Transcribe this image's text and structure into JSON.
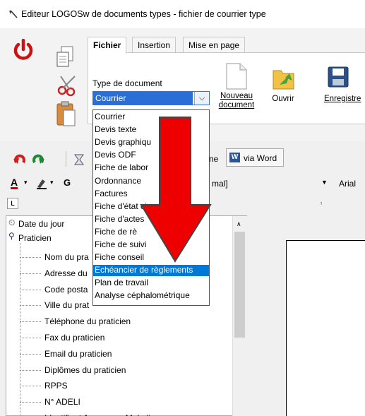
{
  "window": {
    "title": "Editeur LOGOSw de documents types - fichier de courrier type"
  },
  "ribbon": {
    "tabs": [
      {
        "label": "Fichier",
        "active": true
      },
      {
        "label": "Insertion",
        "active": false
      },
      {
        "label": "Mise en page",
        "active": false
      }
    ],
    "doc_type_label": "Type de document",
    "doc_type_value": "Courrier",
    "buttons": {
      "new_line1": "Nouveau",
      "new_line2": "document",
      "open": "Ouvrir",
      "save": "Enregistre"
    }
  },
  "dropdown": {
    "items": [
      "Courrier",
      "Devis texte",
      "Devis graphiqu",
      "Devis ODF",
      "Fiche de labor",
      "Ordonnance",
      "Factures",
      "Fiche d'état ci",
      "Fiche d'actes",
      "Fiche de rè",
      "Fiche de suivi",
      "Fiche conseil",
      "Echéancier de règlements",
      "Plan de travail",
      "Analyse céphalométrique"
    ],
    "selected_index": 12
  },
  "toolbar": {
    "word_button": "via Word",
    "partial_me": "ne",
    "style_value": "mal]",
    "font_value": "Arial"
  },
  "tree": {
    "root_items": [
      "Date du jour",
      "Praticien"
    ],
    "children": [
      "Nom du pra",
      "Adresse du",
      "Code posta",
      "Ville du prat",
      "Téléphone du praticien",
      "Fax du praticien",
      "Email du praticien",
      "Diplômes du praticien",
      "RPPS",
      "N° ADELI",
      "Identifiant Assurance Maladie"
    ]
  },
  "colors": {
    "accent": "#0078d7",
    "arrow": "#ee0000",
    "power": "#cc1111"
  }
}
